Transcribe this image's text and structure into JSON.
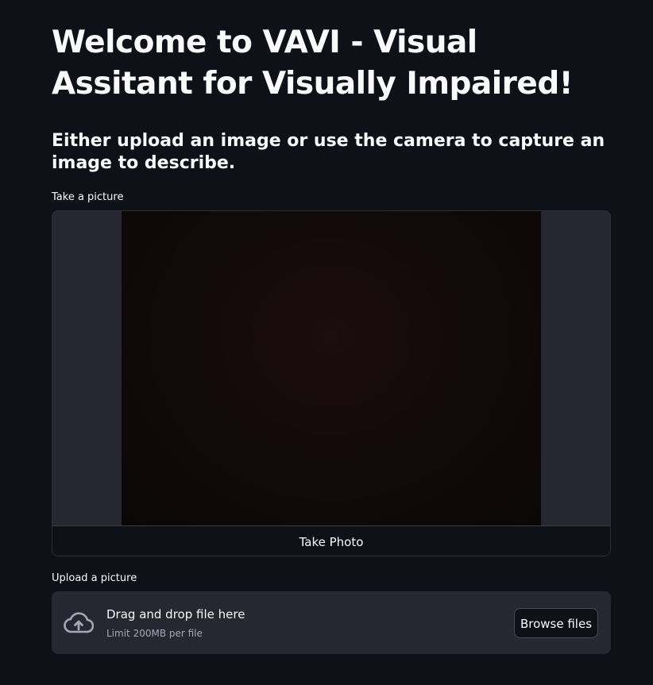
{
  "header": {
    "title": "Welcome to VAVI - Visual Assitant for Visually Impaired!",
    "subtitle": "Either upload an image or use the camera to capture an image to describe."
  },
  "camera_input": {
    "label": "Take a picture",
    "button_label": "Take Photo"
  },
  "file_uploader": {
    "label": "Upload a picture",
    "icon": "cloud-upload-icon",
    "drop_text": "Drag and drop file here",
    "limit_text": "Limit 200MB per file",
    "button_label": "Browse files"
  },
  "colors": {
    "background": "#0e1117",
    "widget_background": "#262730",
    "text": "#fafafa",
    "muted_text": "#a3a8b8"
  }
}
